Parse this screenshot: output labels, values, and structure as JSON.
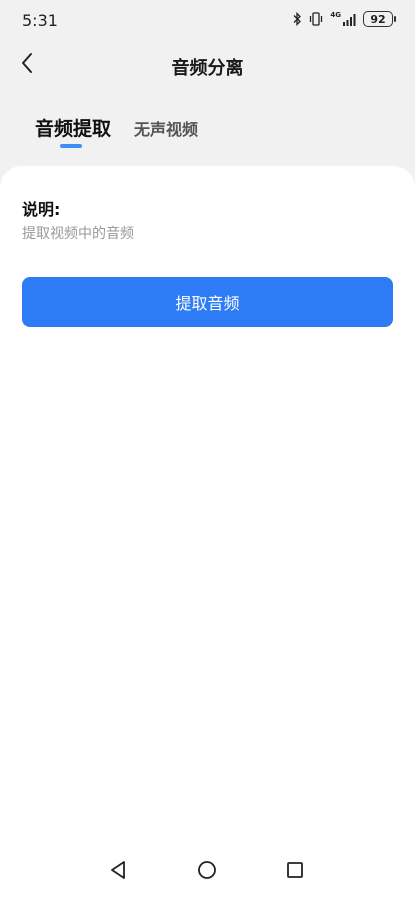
{
  "status_bar": {
    "time": "5:31",
    "network_label": "4G",
    "battery": "92"
  },
  "header": {
    "title": "音频分离",
    "back_icon": "chevron-left-icon"
  },
  "tabs": [
    {
      "label": "音频提取",
      "active": true
    },
    {
      "label": "无声视频",
      "active": false
    }
  ],
  "content": {
    "description_title": "说明:",
    "description_text": "提取视频中的音频",
    "action_button": "提取音频"
  },
  "nav_bar": {
    "buttons": [
      "back-triangle-icon",
      "home-circle-icon",
      "recents-square-icon"
    ]
  },
  "colors": {
    "accent": "#2d7cf6",
    "tab_indicator": "#3d8ff7",
    "background": "#f1f1f1",
    "card": "#ffffff"
  }
}
